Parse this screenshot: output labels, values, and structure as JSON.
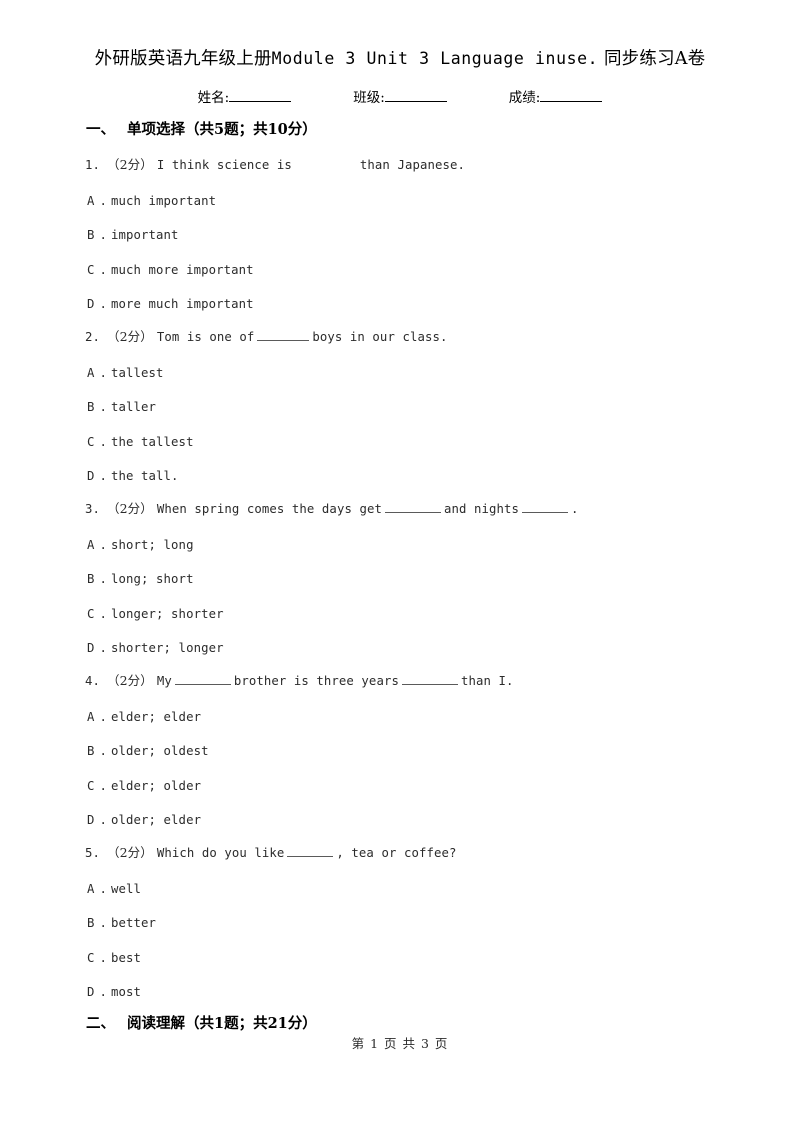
{
  "document": {
    "title_cn_prefix": "外研版英语九年级上册",
    "title_en": "Module 3 Unit 3 Language inuse.",
    "title_cn_suffix": "同步练习A卷",
    "title_full": "外研版英语九年级上册 Module 3 Unit 3 Language inuse. 同步练习A卷"
  },
  "info_row": {
    "name_label": "姓名:",
    "class_label": "班级:",
    "score_label": "成绩:"
  },
  "sections": [
    {
      "number": "一、",
      "title": "单项选择（共5题；共10分）"
    },
    {
      "number": "二、",
      "title": "阅读理解（共1题；共21分）"
    }
  ],
  "questions": [
    {
      "num": "1.",
      "points": "（2分）",
      "text_before": "I think science is",
      "text_after": "than Japanese.",
      "blank_style": "space",
      "options": [
        {
          "letter": "A",
          "dot": ".",
          "text": "much important"
        },
        {
          "letter": "B",
          "dot": ".",
          "text": "important"
        },
        {
          "letter": "C",
          "dot": ".",
          "text": "much more important"
        },
        {
          "letter": "D",
          "dot": ".",
          "text": "more much important"
        }
      ]
    },
    {
      "num": "2.",
      "points": "（2分）",
      "text_before": "Tom is one of",
      "text_after": "boys in our class.",
      "blank_style": "underline",
      "options": [
        {
          "letter": "A",
          "dot": ".",
          "text": "tallest"
        },
        {
          "letter": "B",
          "dot": ".",
          "text": "taller"
        },
        {
          "letter": "C",
          "dot": ".",
          "text": "the tallest"
        },
        {
          "letter": "D",
          "dot": ".",
          "text": "the tall."
        }
      ]
    },
    {
      "num": "3.",
      "points": "（2分）",
      "text_before": "When spring comes the days get",
      "text_middle": "and nights",
      "text_after": ".",
      "blank_style": "double-underline",
      "options": [
        {
          "letter": "A",
          "dot": ".",
          "text": "short; long"
        },
        {
          "letter": "B",
          "dot": ".",
          "text": "long; short"
        },
        {
          "letter": "C",
          "dot": ".",
          "text": "longer; shorter"
        },
        {
          "letter": "D",
          "dot": ".",
          "text": "shorter; longer"
        }
      ]
    },
    {
      "num": "4.",
      "points": "（2分）",
      "text_before": "My",
      "text_middle": "brother is three years",
      "text_after": "than I.",
      "blank_style": "double-underline",
      "options": [
        {
          "letter": "A",
          "dot": ".",
          "text": "elder; elder"
        },
        {
          "letter": "B",
          "dot": ".",
          "text": "older; oldest"
        },
        {
          "letter": "C",
          "dot": ".",
          "text": "elder; older"
        },
        {
          "letter": "D",
          "dot": ".",
          "text": "older; elder"
        }
      ]
    },
    {
      "num": "5.",
      "points": "（2分）",
      "text_before": "Which do you like",
      "text_after": ", tea or coffee?",
      "blank_style": "underline",
      "options": [
        {
          "letter": "A",
          "dot": ".",
          "text": "well"
        },
        {
          "letter": "B",
          "dot": ".",
          "text": "better"
        },
        {
          "letter": "C",
          "dot": ".",
          "text": "best"
        },
        {
          "letter": "D",
          "dot": ".",
          "text": "most"
        }
      ]
    }
  ],
  "footer": {
    "text": "第 1 页 共 3 页"
  }
}
